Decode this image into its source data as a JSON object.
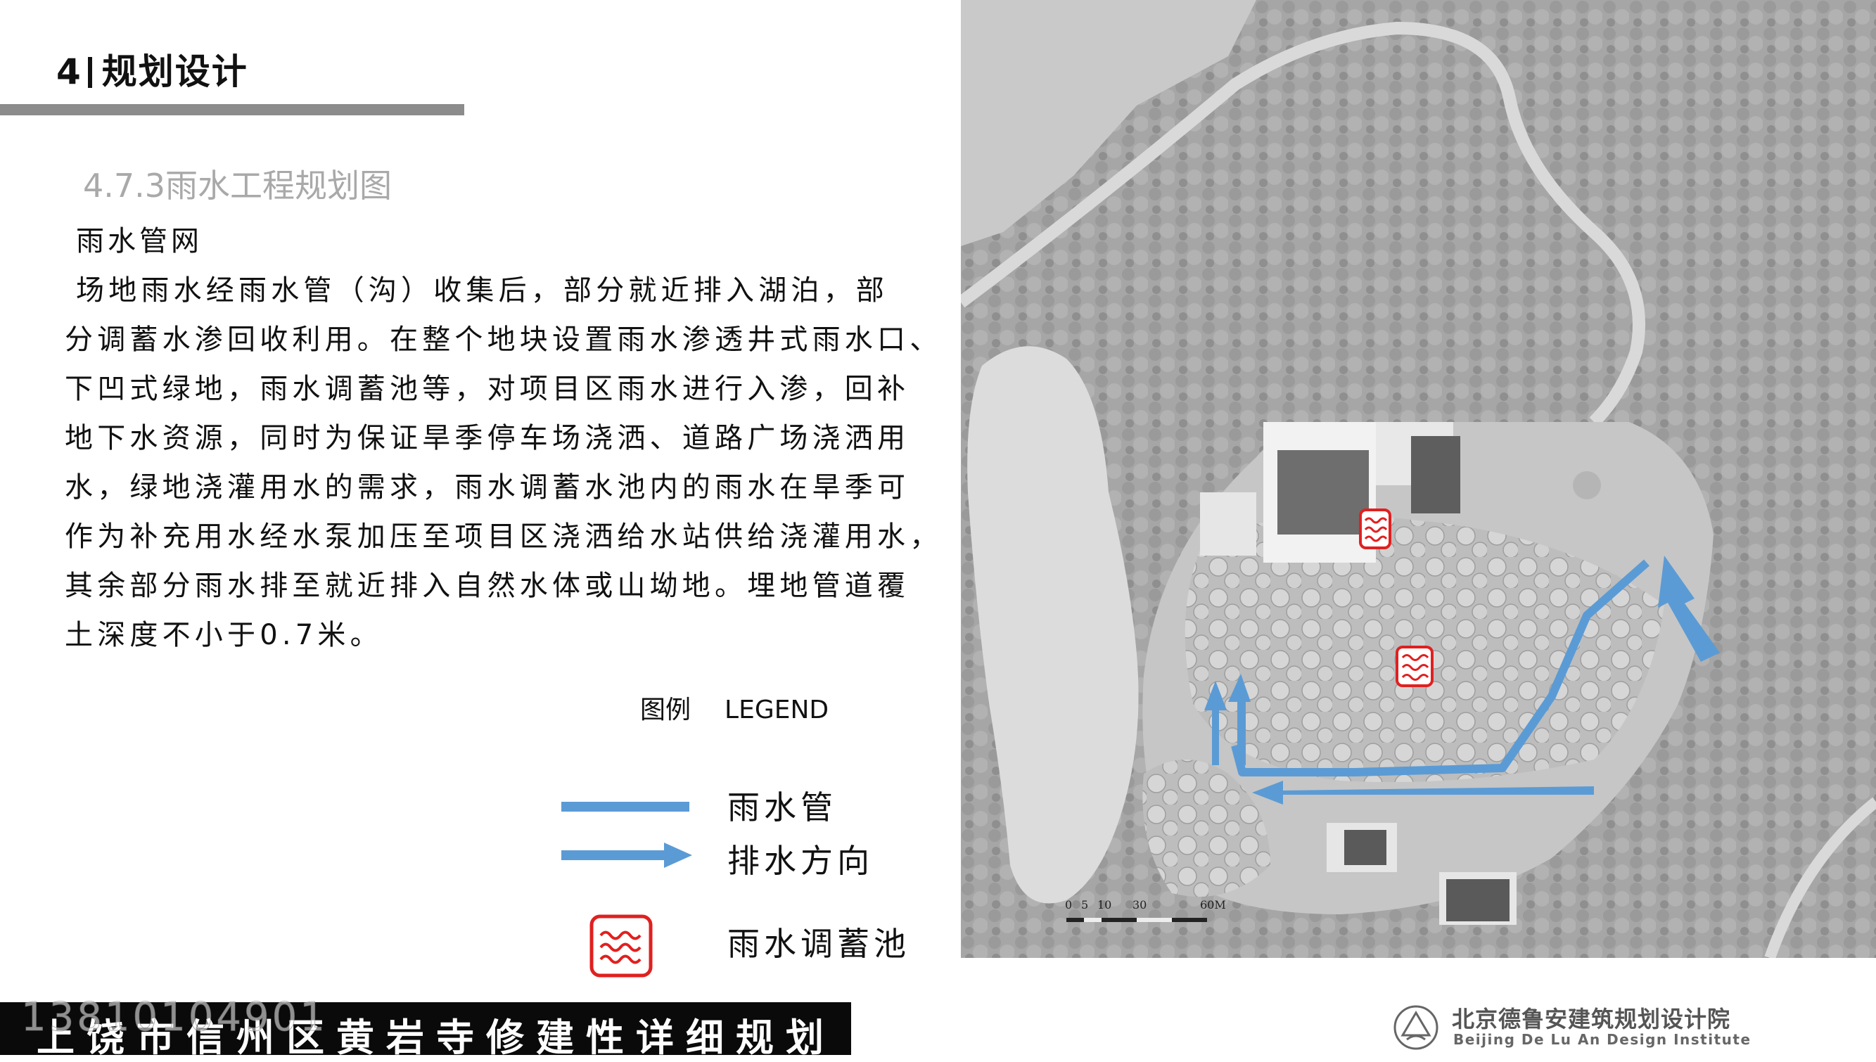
{
  "header": {
    "number": "4",
    "title": "规划设计"
  },
  "subtitle": "4.7.3雨水工程规划图",
  "heading": "雨水管网",
  "body_lines": [
    "场地雨水经雨水管（沟）收集后，部分就近排入湖泊，部",
    "分调蓄水渗回收利用。在整个地块设置雨水渗透井式雨水口、",
    "下凹式绿地，雨水调蓄池等，对项目区雨水进行入渗，回补",
    "地下水资源，同时为保证旱季停车场浇洒、道路广场浇洒用",
    "水，绿地浇灌用水的需求，雨水调蓄水池内的雨水在旱季可",
    "作为补充用水经水泵加压至项目区浇洒给水站供给浇灌用水，",
    "其余部分雨水排至就近排入自然水体或山坳地。埋地管道覆",
    "土深度不小于0.7米。"
  ],
  "legend": {
    "title_cn": "图例",
    "title_en": "LEGEND",
    "items": [
      {
        "label": "雨水管",
        "icon": "pipe-line-icon",
        "color": "#5b9bd5"
      },
      {
        "label": "排水方向",
        "icon": "arrow-right-icon",
        "color": "#5b9bd5"
      },
      {
        "label": "雨水调蓄池",
        "icon": "wave-box-icon",
        "color": "#e02020"
      }
    ]
  },
  "map": {
    "scale_labels": [
      "0",
      "5",
      "10",
      "30",
      "60M"
    ]
  },
  "footer": {
    "title": "上饶市信州区黄岩寺修建性详细规划",
    "phone_watermark": "13810104901"
  },
  "logo": {
    "name_cn": "北京德鲁安建筑规划设计院",
    "name_en": "Beijing De Lu An Design Institute"
  },
  "colors": {
    "pipe": "#5b9bd5",
    "pond": "#e02020",
    "header_rule": "#8c8c8c"
  }
}
